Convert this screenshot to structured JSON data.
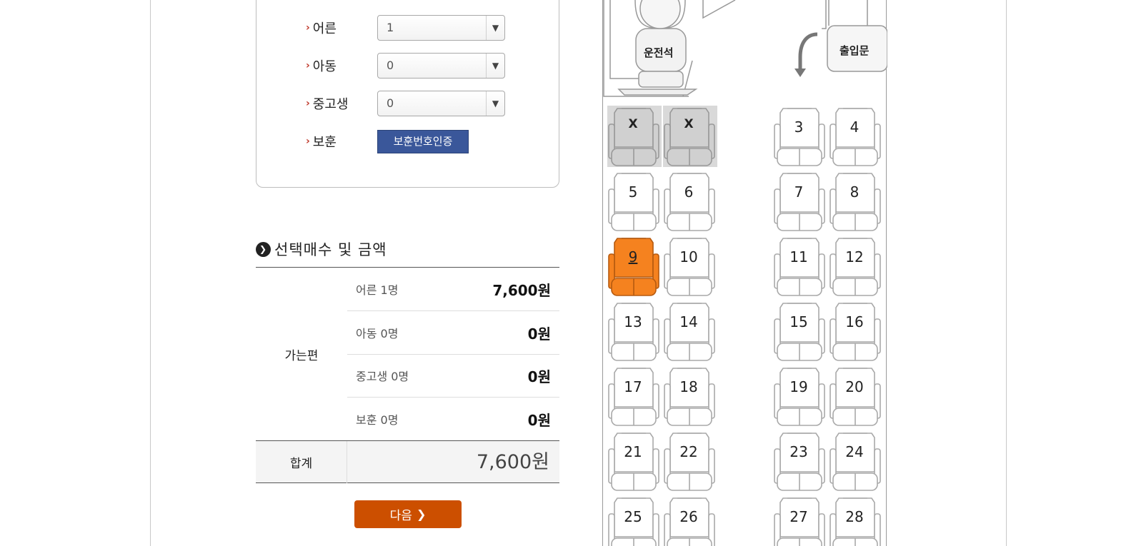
{
  "passengers": [
    {
      "label": "어른",
      "value": "1"
    },
    {
      "label": "아동",
      "value": "0"
    },
    {
      "label": "중고생",
      "value": "0"
    }
  ],
  "veteran": {
    "label": "보훈",
    "button": "보훈번호인증"
  },
  "summary": {
    "title": "선택매수 및 금액",
    "group_label": "가는편",
    "lines": [
      {
        "label": "어른 1명",
        "amount": "7,600원"
      },
      {
        "label": "아동 0명",
        "amount": "0원"
      },
      {
        "label": "중고생 0명",
        "amount": "0원"
      },
      {
        "label": "보훈 0명",
        "amount": "0원"
      }
    ],
    "total_label": "합계",
    "total_amount": "7,600원"
  },
  "next_button": "다음",
  "bus": {
    "driver_label": "운전석",
    "door_label": "출입문",
    "seats": [
      {
        "label": "X",
        "status": "taken"
      },
      {
        "label": "X",
        "status": "taken"
      },
      {
        "label": "3",
        "status": "available"
      },
      {
        "label": "4",
        "status": "available"
      },
      {
        "label": "5",
        "status": "available"
      },
      {
        "label": "6",
        "status": "available"
      },
      {
        "label": "7",
        "status": "available"
      },
      {
        "label": "8",
        "status": "available"
      },
      {
        "label": "9",
        "status": "selected"
      },
      {
        "label": "10",
        "status": "available"
      },
      {
        "label": "11",
        "status": "available"
      },
      {
        "label": "12",
        "status": "available"
      },
      {
        "label": "13",
        "status": "available"
      },
      {
        "label": "14",
        "status": "available"
      },
      {
        "label": "15",
        "status": "available"
      },
      {
        "label": "16",
        "status": "available"
      },
      {
        "label": "17",
        "status": "available"
      },
      {
        "label": "18",
        "status": "available"
      },
      {
        "label": "19",
        "status": "available"
      },
      {
        "label": "20",
        "status": "available"
      },
      {
        "label": "21",
        "status": "available"
      },
      {
        "label": "22",
        "status": "available"
      },
      {
        "label": "23",
        "status": "available"
      },
      {
        "label": "24",
        "status": "available"
      },
      {
        "label": "25",
        "status": "available"
      },
      {
        "label": "26",
        "status": "available"
      },
      {
        "label": "27",
        "status": "available"
      },
      {
        "label": "28",
        "status": "available"
      }
    ]
  },
  "colors": {
    "selected": "#f5821f",
    "taken": "#d9d9d9",
    "next": "#cc4f00",
    "veteran": "#3a579a"
  }
}
